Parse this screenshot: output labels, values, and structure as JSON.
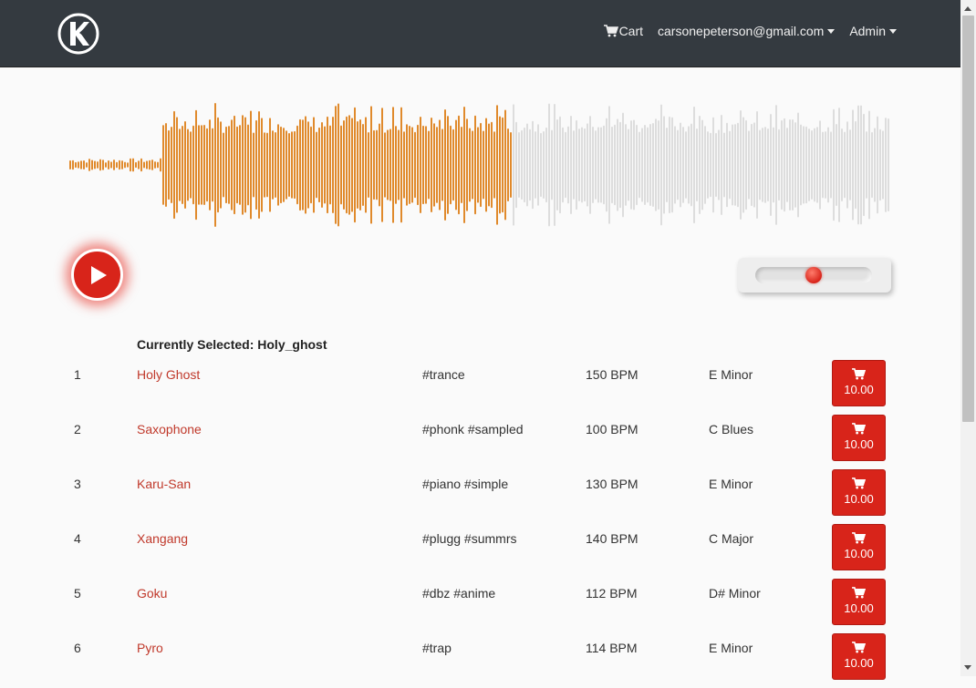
{
  "nav": {
    "cart_label": "Cart",
    "user_email": "carsonepeterson@gmail.com",
    "admin_label": "Admin"
  },
  "player": {
    "progress": 0.54,
    "volume": 0.5,
    "played_color": "#e08a2c",
    "unplayed_color": "#dddddd",
    "accent": "#d8241a"
  },
  "current": {
    "label": "Currently Selected: Holy_ghost"
  },
  "tracks": [
    {
      "num": "1",
      "title": "Holy Ghost",
      "tags": "#trance",
      "bpm": "150 BPM",
      "key": "E Minor",
      "price": "10.00"
    },
    {
      "num": "2",
      "title": "Saxophone",
      "tags": "#phonk #sampled",
      "bpm": "100 BPM",
      "key": "C Blues",
      "price": "10.00"
    },
    {
      "num": "3",
      "title": "Karu-San",
      "tags": "#piano #simple",
      "bpm": "130 BPM",
      "key": "E Minor",
      "price": "10.00"
    },
    {
      "num": "4",
      "title": "Xangang",
      "tags": "#plugg #summrs",
      "bpm": "140 BPM",
      "key": "C Major",
      "price": "10.00"
    },
    {
      "num": "5",
      "title": "Goku",
      "tags": "#dbz #anime",
      "bpm": "112 BPM",
      "key": "D# Minor",
      "price": "10.00"
    },
    {
      "num": "6",
      "title": "Pyro",
      "tags": "#trap",
      "bpm": "114 BPM",
      "key": "E Minor",
      "price": "10.00"
    }
  ]
}
